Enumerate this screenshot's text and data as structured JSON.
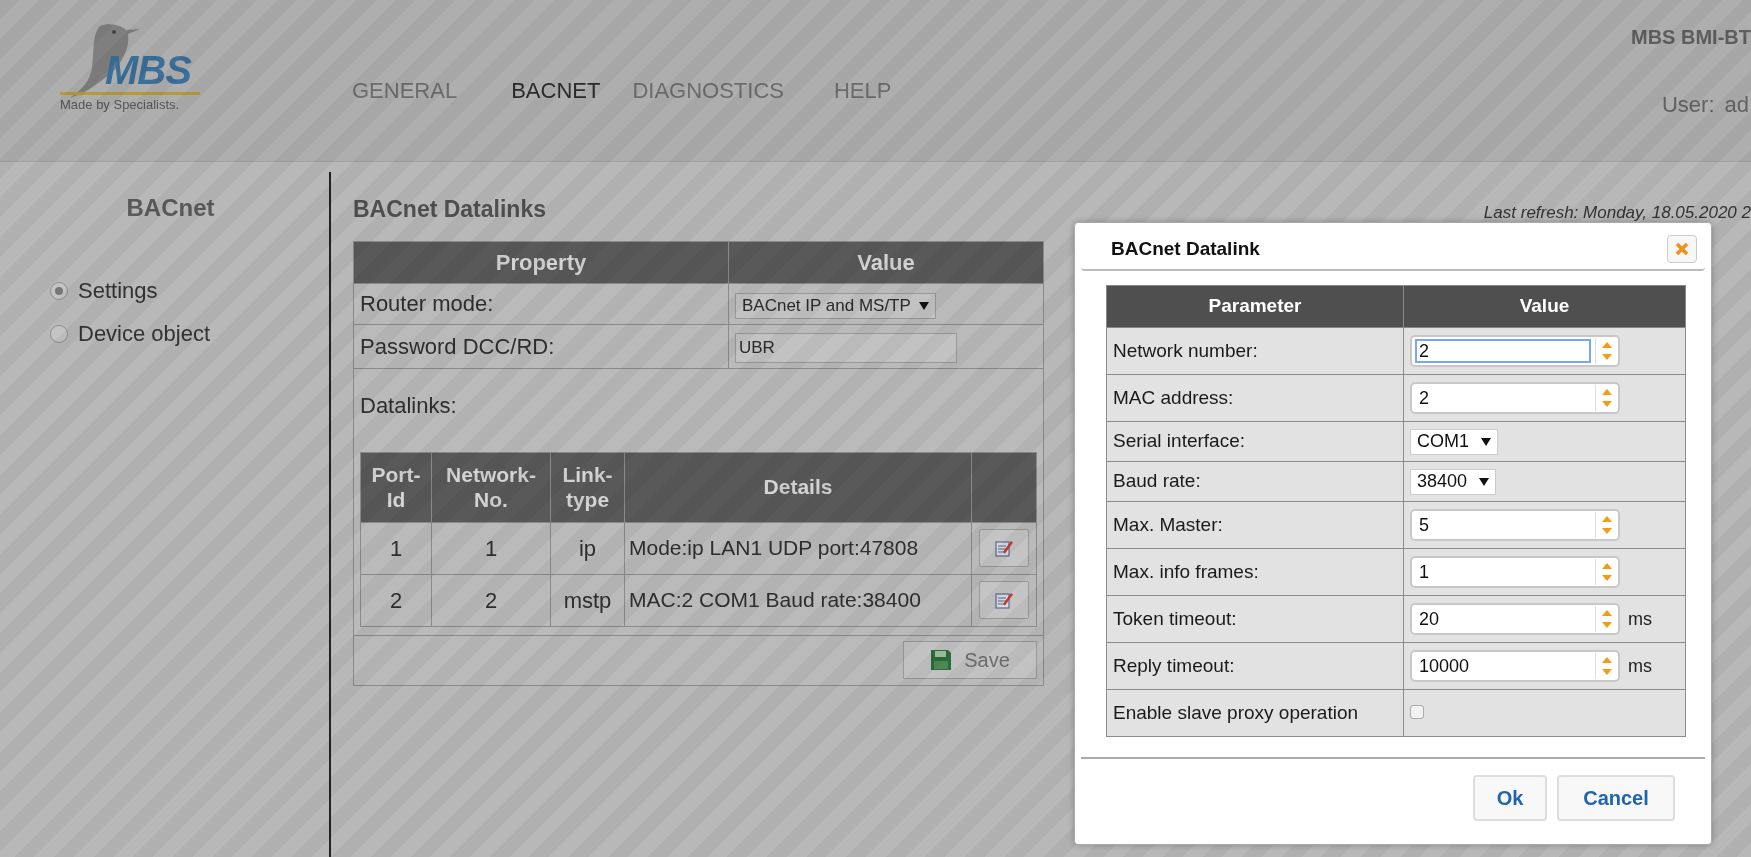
{
  "header": {
    "logo_text": "MBS",
    "logo_tagline": "Made by Specialists.",
    "nav": [
      {
        "label": "GENERAL",
        "selected": false
      },
      {
        "label": "BACNET",
        "selected": true
      },
      {
        "label": "DIAGNOSTICS",
        "selected": false
      },
      {
        "label": "HELP",
        "selected": false
      }
    ],
    "device_title": "MBS BMI-BT",
    "user_label": "User:",
    "user_name": "ad"
  },
  "sidebar": {
    "title": "BACnet",
    "items": [
      {
        "label": "Settings",
        "selected": true
      },
      {
        "label": "Device object",
        "selected": false
      }
    ]
  },
  "main": {
    "title": "BACnet Datalinks",
    "last_refresh": "Last refresh: Monday, 18.05.2020 2",
    "properties": {
      "columns": [
        "Property",
        "Value"
      ],
      "rows": [
        {
          "label": "Router mode:",
          "kind": "select",
          "value": "BACnet IP and MS/TP"
        },
        {
          "label": "Password DCC/RD:",
          "kind": "text",
          "value": "UBR"
        }
      ]
    },
    "datalinks_label": "Datalinks:",
    "datalinks": {
      "columns": [
        "Port-Id",
        "Network-No.",
        "Link-type",
        "Details"
      ],
      "rows": [
        {
          "port_id": "1",
          "network_no": "1",
          "link_type": "ip",
          "details": "Mode:ip LAN1 UDP port:47808"
        },
        {
          "port_id": "2",
          "network_no": "2",
          "link_type": "mstp",
          "details": "MAC:2 COM1 Baud rate:38400"
        }
      ]
    },
    "save_button": "Save"
  },
  "dialog": {
    "title": "BACnet Datalink",
    "columns": [
      "Parameter",
      "Value"
    ],
    "rows": [
      {
        "label": "Network number:",
        "kind": "number",
        "value": "2",
        "focused": true
      },
      {
        "label": "MAC address:",
        "kind": "number",
        "value": "2",
        "focused": false
      },
      {
        "label": "Serial interface:",
        "kind": "select",
        "value": "COM1"
      },
      {
        "label": "Baud rate:",
        "kind": "select",
        "value": "38400"
      },
      {
        "label": "Max. Master:",
        "kind": "number",
        "value": "5",
        "focused": false
      },
      {
        "label": "Max. info frames:",
        "kind": "number",
        "value": "1",
        "focused": false
      },
      {
        "label": "Token timeout:",
        "kind": "number",
        "value": "20",
        "focused": false,
        "unit": "ms"
      },
      {
        "label": "Reply timeout:",
        "kind": "number",
        "value": "10000",
        "focused": false,
        "unit": "ms"
      },
      {
        "label": "Enable slave proxy operation",
        "kind": "checkbox",
        "checked": false
      }
    ],
    "buttons": [
      "Ok",
      "Cancel"
    ]
  }
}
